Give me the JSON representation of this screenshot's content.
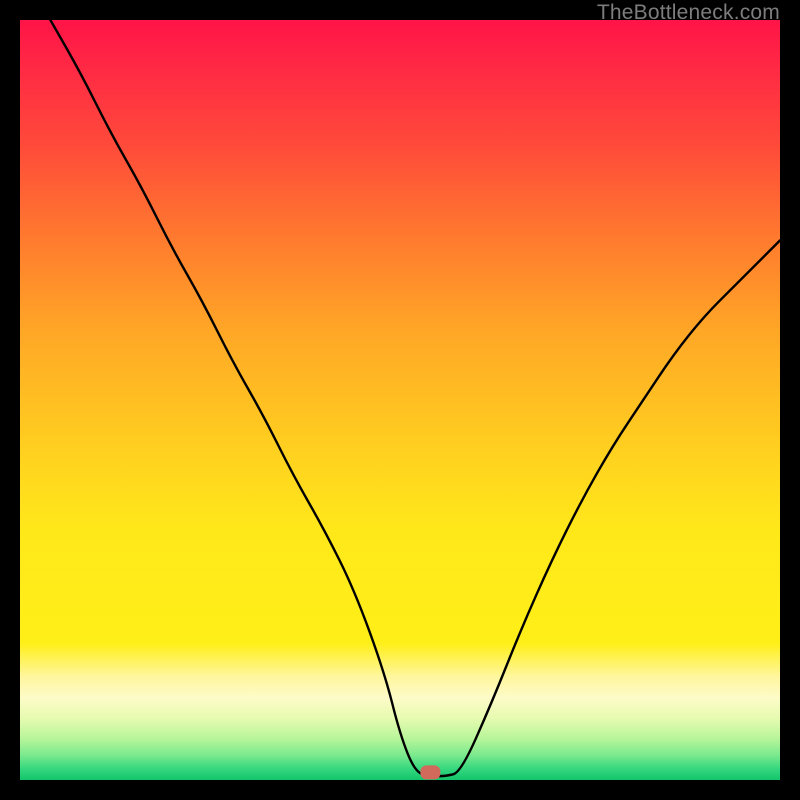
{
  "watermark": "TheBottleneck.com",
  "chart_data": {
    "type": "line",
    "title": "",
    "xlabel": "",
    "ylabel": "",
    "xlim": [
      0,
      100
    ],
    "ylim": [
      0,
      100
    ],
    "grid": false,
    "legend": false,
    "annotations": [
      {
        "name": "marker",
        "x": 54,
        "y": 1,
        "color": "#d26a5c",
        "shape": "rounded"
      }
    ],
    "series": [
      {
        "name": "bottleneck-curve",
        "color": "#000000",
        "x": [
          4,
          8,
          12,
          16,
          20,
          24,
          28,
          32,
          36,
          40,
          44,
          48,
          50,
          52,
          54,
          56,
          58,
          62,
          66,
          70,
          74,
          78,
          82,
          86,
          90,
          94,
          98,
          100
        ],
        "y": [
          100,
          93,
          85,
          78,
          70,
          63,
          55,
          48,
          40,
          33,
          25,
          14,
          6,
          1,
          0.5,
          0.5,
          1,
          10,
          20,
          29,
          37,
          44,
          50,
          56,
          61,
          65,
          69,
          71
        ]
      }
    ],
    "background": {
      "type": "vertical-gradient",
      "stops": [
        {
          "pos": 0,
          "color": "#ff1447"
        },
        {
          "pos": 50,
          "color": "#ffa726"
        },
        {
          "pos": 80,
          "color": "#ffef18"
        },
        {
          "pos": 100,
          "color": "#13c46a"
        }
      ]
    }
  }
}
